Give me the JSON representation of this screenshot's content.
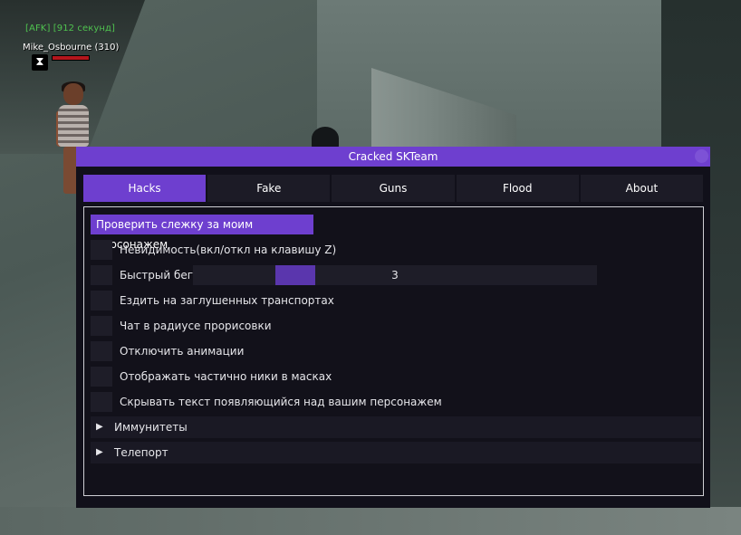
{
  "overlay": {
    "afk_status": "[AFK] [912 секунд]",
    "player_name": "Mike_Osbourne (310)",
    "afk_badge_icon": "hourglass-icon",
    "health_bar_color": "#b3161c"
  },
  "window": {
    "title": "Cracked SKTeam",
    "accent_color": "#6e3fcf",
    "tabs": [
      {
        "label": "Hacks",
        "active": true
      },
      {
        "label": "Fake",
        "active": false
      },
      {
        "label": "Guns",
        "active": false
      },
      {
        "label": "Flood",
        "active": false
      },
      {
        "label": "About",
        "active": false
      }
    ],
    "hacks": {
      "track_button": "Проверить слежку за моим персонажем",
      "options": [
        {
          "label": "Невидимость(вкл/откл на клавишу Z)",
          "checked": false
        },
        {
          "label": "Быстрый бег",
          "checked": false
        },
        {
          "label": "Ездить на заглушенных транспортах",
          "checked": false
        },
        {
          "label": "Чат в радиусе прорисовки",
          "checked": false
        },
        {
          "label": "Отключить анимации",
          "checked": false
        },
        {
          "label": "Отображать частично ники в масках",
          "checked": false
        },
        {
          "label": "Скрывать текст появляющийся над вашим персонажем",
          "checked": false
        }
      ],
      "run_speed_value": "3",
      "sections": [
        {
          "label": "Иммунитеты",
          "icon": "triangle-right-icon"
        },
        {
          "label": "Телепорт",
          "icon": "triangle-right-icon"
        }
      ]
    }
  }
}
